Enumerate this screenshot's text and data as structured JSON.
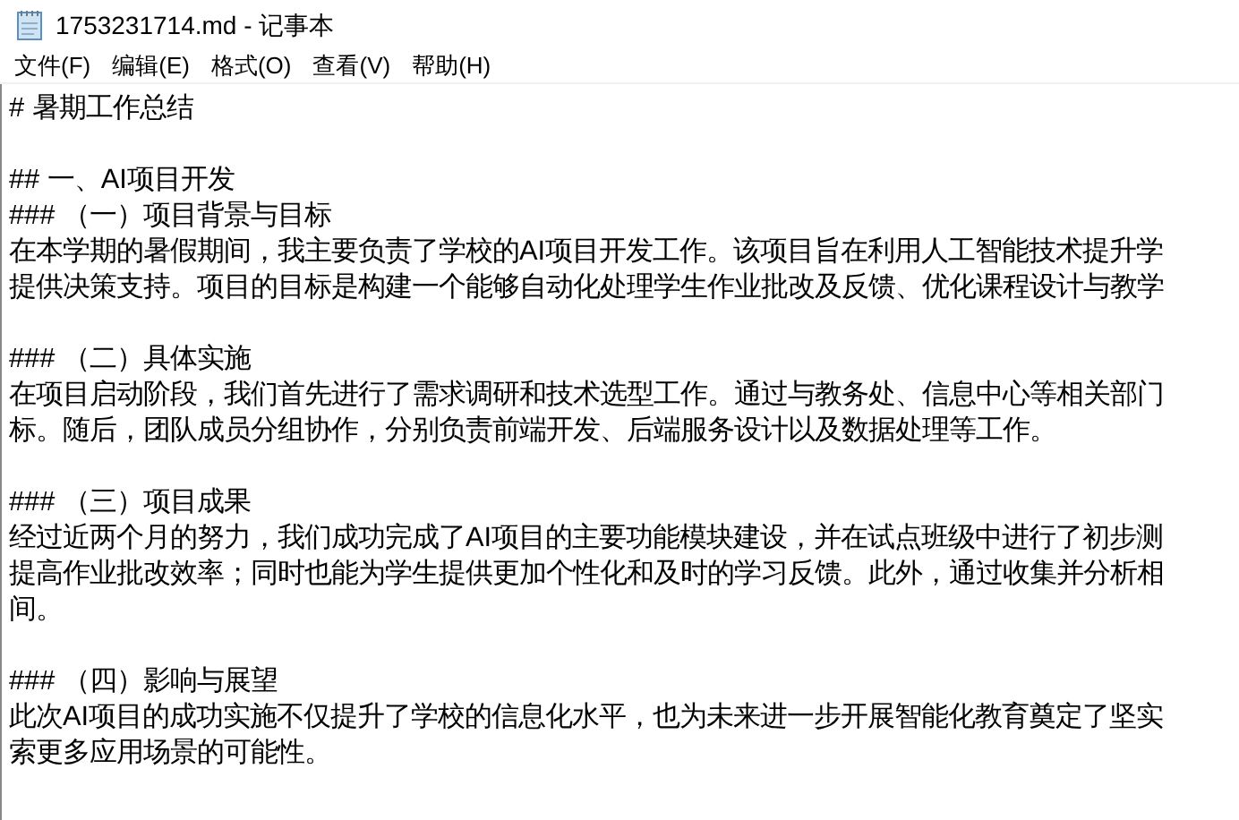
{
  "window": {
    "title": "1753231714.md - 记事本"
  },
  "menu": [
    {
      "label": "文件(F)"
    },
    {
      "label": "编辑(E)"
    },
    {
      "label": "格式(O)"
    },
    {
      "label": "查看(V)"
    },
    {
      "label": "帮助(H)"
    }
  ],
  "document": {
    "blocks": [
      [
        "# 暑期工作总结"
      ],
      [
        "## 一、AI项目开发",
        "### （一）项目背景与目标",
        "在本学期的暑假期间，我主要负责了学校的AI项目开发工作。该项目旨在利用人工智能技术提升学",
        "提供决策支持。项目的目标是构建一个能够自动化处理学生作业批改及反馈、优化课程设计与教学"
      ],
      [
        "### （二）具体实施",
        "在项目启动阶段，我们首先进行了需求调研和技术选型工作。通过与教务处、信息中心等相关部门",
        "标。随后，团队成员分组协作，分别负责前端开发、后端服务设计以及数据处理等工作。"
      ],
      [
        "### （三）项目成果",
        "经过近两个月的努力，我们成功完成了AI项目的主要功能模块建设，并在试点班级中进行了初步测",
        "提高作业批改效率；同时也能为学生提供更加个性化和及时的学习反馈。此外，通过收集并分析相",
        "间。"
      ],
      [
        "### （四）影响与展望",
        "此次AI项目的成功实施不仅提升了学校的信息化水平，也为未来进一步开展智能化教育奠定了坚实",
        "索更多应用场景的可能性。"
      ]
    ]
  }
}
